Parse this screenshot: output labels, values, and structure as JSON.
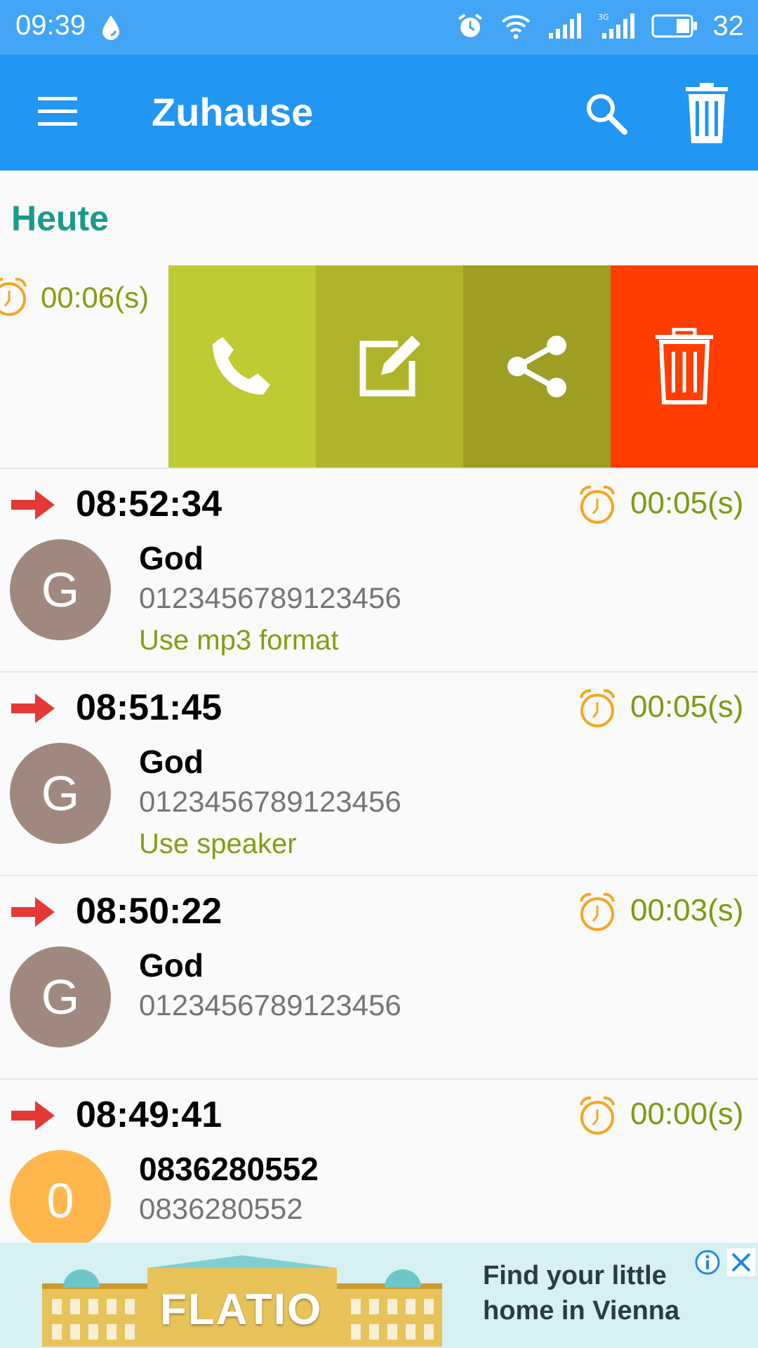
{
  "status_bar": {
    "time": "09:39",
    "battery_level": "32",
    "icons": [
      "drop-icon",
      "alarm-icon",
      "wifi-icon",
      "signal-icon",
      "3g-signal-icon",
      "battery-icon"
    ]
  },
  "app_bar": {
    "title": "Zuhause",
    "icons": [
      "menu-icon",
      "search-icon",
      "trash-icon"
    ],
    "color": "#2196f3"
  },
  "section": {
    "header": "Heute"
  },
  "swiped_row": {
    "duration": "00:06(s)",
    "actions": [
      {
        "name": "call",
        "icon": "phone-icon",
        "color": "#c0ca33"
      },
      {
        "name": "edit",
        "icon": "edit-icon",
        "color": "#afb42b"
      },
      {
        "name": "share",
        "icon": "share-icon",
        "color": "#9e9d24"
      },
      {
        "name": "delete",
        "icon": "trash-icon",
        "color": "#ff3d00"
      }
    ]
  },
  "calls": [
    {
      "time": "08:52:34",
      "duration": "00:05(s)",
      "avatar_letter": "G",
      "avatar_color": "#a1887f",
      "name": "God",
      "number": "0123456789123456",
      "note": "Use mp3 format"
    },
    {
      "time": "08:51:45",
      "duration": "00:05(s)",
      "avatar_letter": "G",
      "avatar_color": "#a1887f",
      "name": "God",
      "number": "0123456789123456",
      "note": "Use speaker"
    },
    {
      "time": "08:50:22",
      "duration": "00:03(s)",
      "avatar_letter": "G",
      "avatar_color": "#a1887f",
      "name": "God",
      "number": "0123456789123456",
      "note": ""
    },
    {
      "time": "08:49:41",
      "duration": "00:00(s)",
      "avatar_letter": "0",
      "avatar_color": "#ffb74d",
      "name": "0836280552",
      "number": "0836280552",
      "note": ""
    }
  ],
  "ad": {
    "brand": "FLATIO",
    "text": "Find your little home in Vienna",
    "icons": [
      "info-icon",
      "close-icon"
    ]
  }
}
